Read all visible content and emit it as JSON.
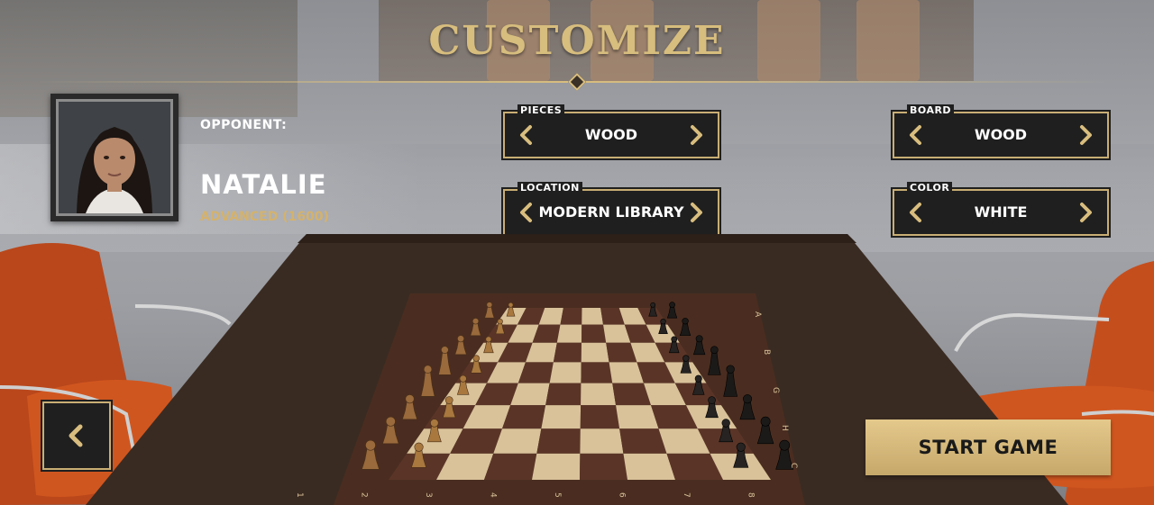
{
  "title": "CUSTOMIZE",
  "opponent": {
    "label": "OPPONENT:",
    "name": "NATALIE",
    "level": "ADVANCED (1600)"
  },
  "selectors": {
    "pieces": {
      "label": "PIECES",
      "value": "WOOD"
    },
    "board": {
      "label": "BOARD",
      "value": "WOOD"
    },
    "location": {
      "label": "LOCATION",
      "value": "MODERN LIBRARY"
    },
    "color": {
      "label": "COLOR",
      "value": "WHITE"
    }
  },
  "board_notation": {
    "near_numbers": [
      "1",
      "2",
      "3",
      "4",
      "5",
      "6",
      "7",
      "8"
    ],
    "side_letters": [
      "C",
      "H",
      "G",
      "B",
      "A"
    ]
  },
  "buttons": {
    "start": "START GAME",
    "back_icon": "chevron-left-icon"
  },
  "colors": {
    "gold": "#d8bd7e",
    "panel": "#1f1f1f",
    "start_button": "#d9bd80"
  }
}
